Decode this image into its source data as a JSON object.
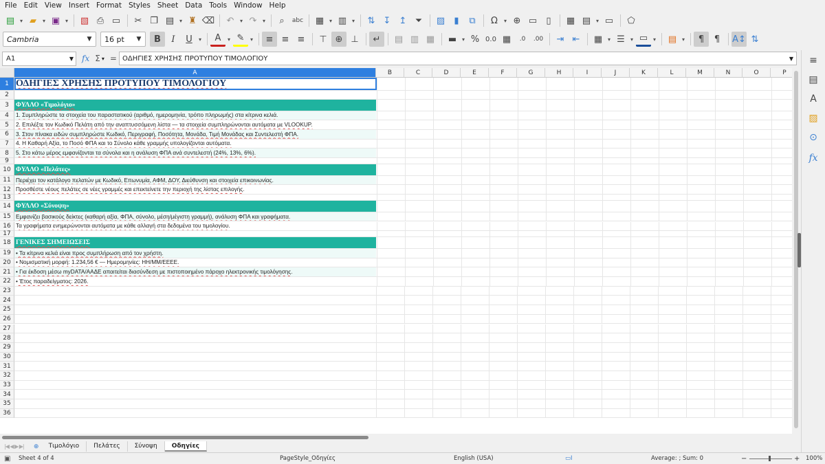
{
  "menu": [
    "File",
    "Edit",
    "View",
    "Insert",
    "Format",
    "Styles",
    "Sheet",
    "Data",
    "Tools",
    "Window",
    "Help"
  ],
  "font": {
    "name": "Cambria",
    "size": "16 pt"
  },
  "namebox": "A1",
  "formula": "ΟΔΗΓΙΕΣ ΧΡΗΣΗΣ ΠΡΟΤΥΠΟΥ ΤΙΜΟΛΟΓΙΟΥ",
  "columns": [
    "A",
    "B",
    "C",
    "D",
    "E",
    "F",
    "G",
    "H",
    "I",
    "J",
    "K",
    "L",
    "M",
    "N",
    "O",
    "P"
  ],
  "rows": [
    {
      "n": "1",
      "text": "ΟΔΗΓΙΕΣ ΧΡΗΣΗΣ ΠΡΟΤΥΠΟΥ ΤΙΜΟΛΟΓΙΟΥ",
      "style": "title"
    },
    {
      "n": "2",
      "text": "",
      "style": "plain"
    },
    {
      "n": "3",
      "text": "ΦΥΛΛΟ «Τιμολόγιο»",
      "style": "sect"
    },
    {
      "n": "4",
      "text": "1. Συμπληρώστε τα στοιχεία του παραστατικού (αριθμό, ημερομηνία, τρόπο πληρωμής) στα κίτρινα κελιά.",
      "style": "band"
    },
    {
      "n": "5",
      "text": "2. Επιλέξτε τον Κωδικό Πελάτη από την αναπτυσσόμενη λίστα — τα στοιχεία συμπληρώνονται αυτόματα με VLOOKUP.",
      "style": "plain"
    },
    {
      "n": "6",
      "text": "3. Στον πίνακα ειδών συμπληρώστε Κωδικό, Περιγραφή, Ποσότητα, Μονάδα, Τιμή Μονάδας και Συντελεστή ΦΠΑ.",
      "style": "band"
    },
    {
      "n": "7",
      "text": "4. Η Καθαρή Αξία, το Ποσό ΦΠΑ και το Σύνολο κάθε γραμμής υπολογίζονται αυτόματα.",
      "style": "plain"
    },
    {
      "n": "8",
      "text": "5. Στο κάτω μέρος εμφανίζονται τα σύνολα και η ανάλυση ΦΠΑ ανά συντελεστή (24%, 13%, 6%).",
      "style": "band"
    },
    {
      "n": "9",
      "text": "",
      "style": "plain"
    },
    {
      "n": "10",
      "text": "ΦΥΛΛΟ «Πελάτες»",
      "style": "sect"
    },
    {
      "n": "11",
      "text": "Περιέχει τον κατάλογο πελατών με Κωδικό, Επωνυμία, ΑΦΜ, ΔΟΥ, Διεύθυνση και στοιχεία επικοινωνίας.",
      "style": "band"
    },
    {
      "n": "12",
      "text": "Προσθέστε νέους πελάτες σε νέες γραμμές και επεκτείνετε την περιοχή της λίστας επιλογής.",
      "style": "plain"
    },
    {
      "n": "13",
      "text": "",
      "style": "plain"
    },
    {
      "n": "14",
      "text": "ΦΥΛΛΟ «Σύνοψη»",
      "style": "sect"
    },
    {
      "n": "15",
      "text": "Εμφανίζει βασικούς δείκτες (καθαρή αξία, ΦΠΑ, σύνολο, μέση/μέγιστη γραμμή), ανάλυση ΦΠΑ και γραφήματα.",
      "style": "band"
    },
    {
      "n": "16",
      "text": "Τα γραφήματα ενημερώνονται αυτόματα με κάθε αλλαγή στα δεδομένα του τιμολογίου.",
      "style": "plain"
    },
    {
      "n": "17",
      "text": "",
      "style": "plain"
    },
    {
      "n": "18",
      "text": "ΓΕΝΙΚΕΣ ΣΗΜΕΙΩΣΕΙΣ",
      "style": "sect"
    },
    {
      "n": "19",
      "text": "• Τα κίτρινα κελιά είναι προς συμπλήρωση από τον χρήστη.",
      "style": "band"
    },
    {
      "n": "20",
      "text": "• Νομισματική μορφή: 1.234,56 € — Ημερομηνίες: ΗΗ/ΜΜ/ΕΕΕΕ.",
      "style": "plain"
    },
    {
      "n": "21",
      "text": "• Για έκδοση μέσω myDATA/ΑΑΔΕ απαιτείται διασύνδεση με πιστοποιημένο πάροχο ηλεκτρονικής τιμολόγησης.",
      "style": "band"
    },
    {
      "n": "22",
      "text": "• Έτος παραδείγματος: 2026.",
      "style": "plain"
    }
  ],
  "empty_rows": [
    "23",
    "24",
    "25",
    "26",
    "27",
    "28",
    "29",
    "30",
    "31",
    "32",
    "33",
    "34",
    "35",
    "36"
  ],
  "tabs": [
    "Τιμολόγιο",
    "Πελάτες",
    "Σύνοψη",
    "Οδηγίες"
  ],
  "active_tab": "Οδηγίες",
  "status": {
    "sheet": "Sheet 4 of 4",
    "pagestyle": "PageStyle_Οδηγίες",
    "language": "English (USA)",
    "summary": "Average: ; Sum: 0",
    "zoom": "100%"
  },
  "colors": {
    "accent": "#1fb39f",
    "selection": "#2e7fe0",
    "title": "#1a3a6b"
  }
}
